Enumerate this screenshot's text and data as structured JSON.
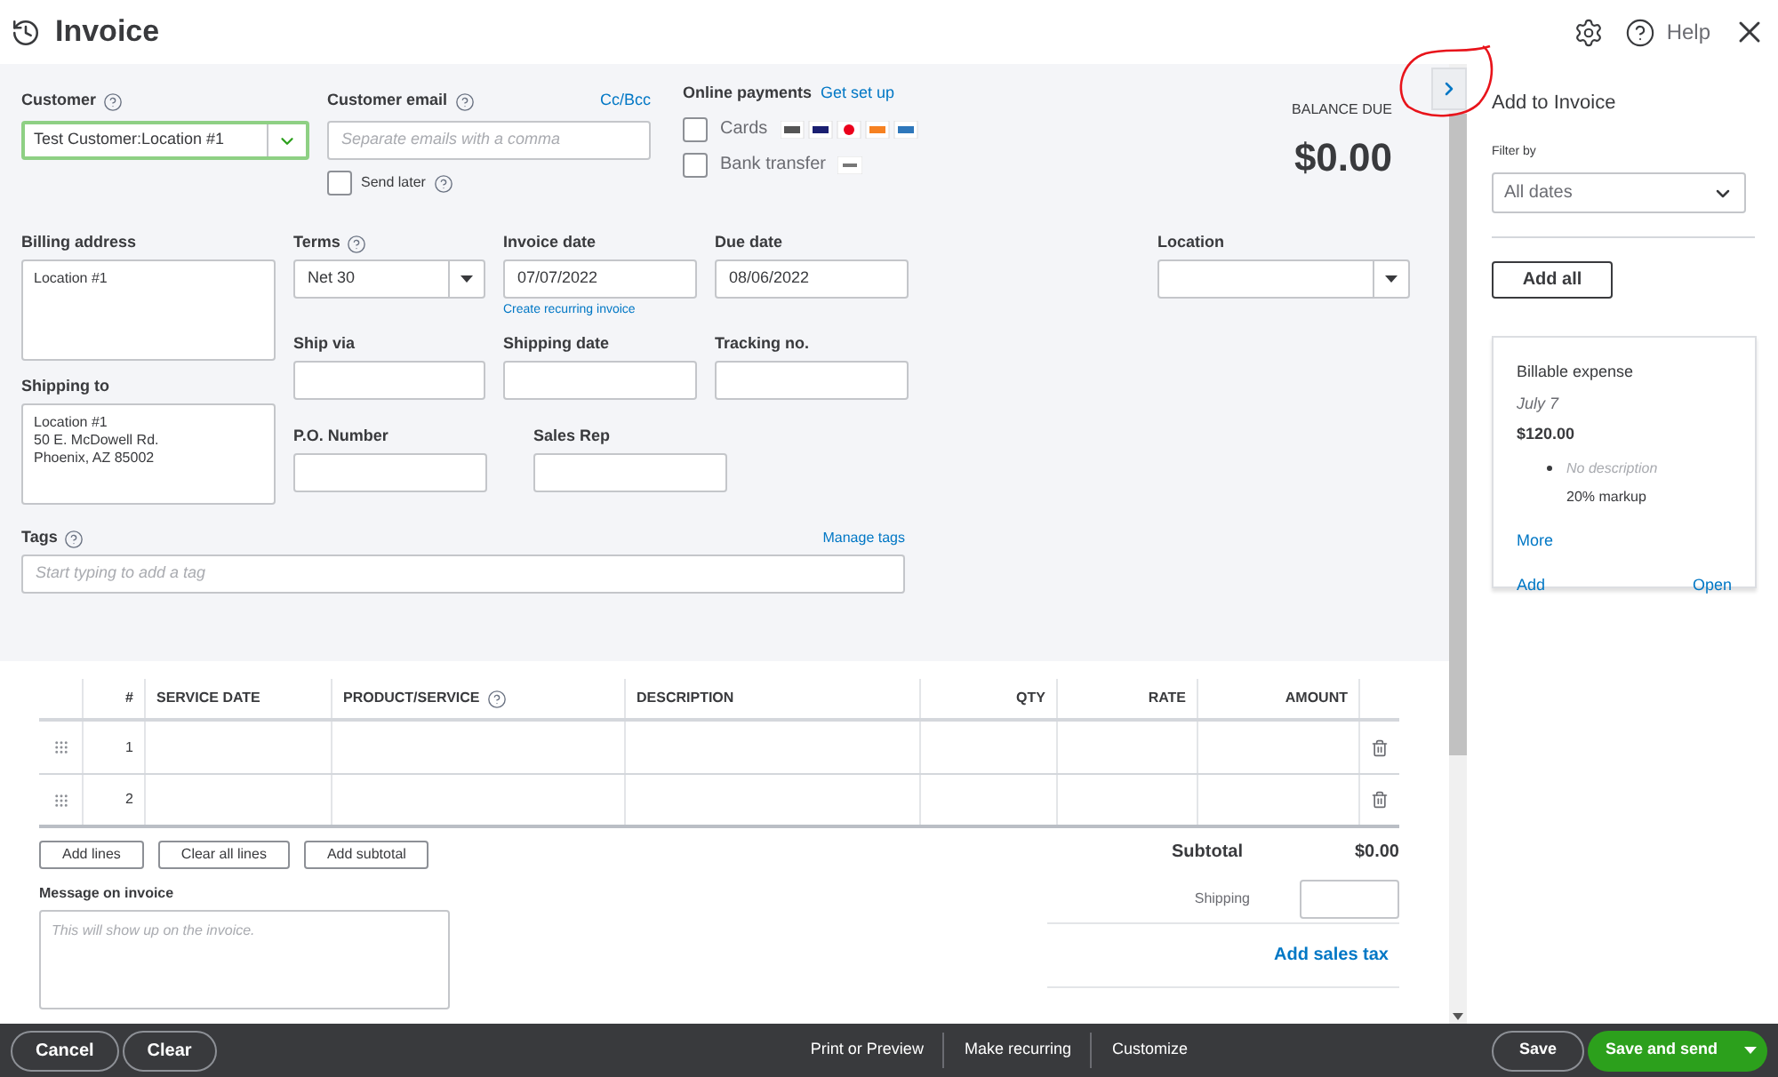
{
  "header": {
    "title": "Invoice",
    "help": "Help"
  },
  "customer": {
    "label": "Customer",
    "value": "Test Customer:Location #1"
  },
  "email": {
    "label": "Customer email",
    "link": "Cc/Bcc",
    "placeholder": "Separate emails with a comma",
    "send_later": {
      "label": "Send later",
      "checked": false
    }
  },
  "online_payments": {
    "label": "Online payments",
    "link": "Get set up",
    "options": [
      {
        "label": "Cards",
        "checked": false,
        "kind": "cards"
      },
      {
        "label": "Bank transfer",
        "checked": false,
        "kind": "bank"
      }
    ]
  },
  "balance_due": {
    "label": "BALANCE DUE",
    "amount": "$0.00"
  },
  "billing_address": {
    "label": "Billing address",
    "lines": [
      "Location #1"
    ]
  },
  "shipping_to": {
    "label": "Shipping to",
    "lines": [
      "Location #1",
      "50 E. McDowell Rd.",
      "Phoenix, AZ  85002"
    ]
  },
  "terms": {
    "label": "Terms",
    "value": "Net 30"
  },
  "invoice_date": {
    "label": "Invoice date",
    "value": "07/07/2022",
    "link": "Create recurring invoice"
  },
  "due_date": {
    "label": "Due date",
    "value": "08/06/2022"
  },
  "location": {
    "label": "Location"
  },
  "ship_via": {
    "label": "Ship via"
  },
  "shipping_date": {
    "label": "Shipping date"
  },
  "tracking_no": {
    "label": "Tracking no."
  },
  "po_number": {
    "label": "P.O. Number"
  },
  "sales_rep": {
    "label": "Sales Rep"
  },
  "tags": {
    "label": "Tags",
    "link": "Manage tags",
    "placeholder": "Start typing to add a tag"
  },
  "table": {
    "columns": [
      {
        "label": "#",
        "help": false
      },
      {
        "label": "SERVICE DATE",
        "help": false
      },
      {
        "label": "PRODUCT/SERVICE",
        "help": true
      },
      {
        "label": "DESCRIPTION",
        "help": false
      },
      {
        "label": "QTY",
        "help": false
      },
      {
        "label": "RATE",
        "help": false
      },
      {
        "label": "AMOUNT",
        "help": false
      }
    ],
    "rows": [
      {
        "number": "1"
      },
      {
        "number": "2"
      }
    ]
  },
  "line_buttons": [
    "Add lines",
    "Clear all lines",
    "Add subtotal"
  ],
  "message": {
    "label": "Message on invoice",
    "placeholder": "This will show up on the invoice."
  },
  "totals": {
    "subtotal_label": "Subtotal",
    "subtotal": "$0.00",
    "shipping_label": "Shipping",
    "sales_tax_link": "Add sales tax"
  },
  "sidebar": {
    "title": "Add to Invoice",
    "filter_label": "Filter by",
    "filter_value": "All dates",
    "add_all": "Add all",
    "card": {
      "title": "Billable expense",
      "date": "July 7",
      "amount": "$120.00",
      "description": "No description",
      "markup": "20% markup",
      "more": "More",
      "add": "Add",
      "open": "Open"
    }
  },
  "footer": {
    "left": [
      "Cancel",
      "Clear"
    ],
    "middle": [
      "Print or Preview",
      "Make recurring",
      "Customize"
    ],
    "save": "Save",
    "save_send": "Save and send"
  }
}
